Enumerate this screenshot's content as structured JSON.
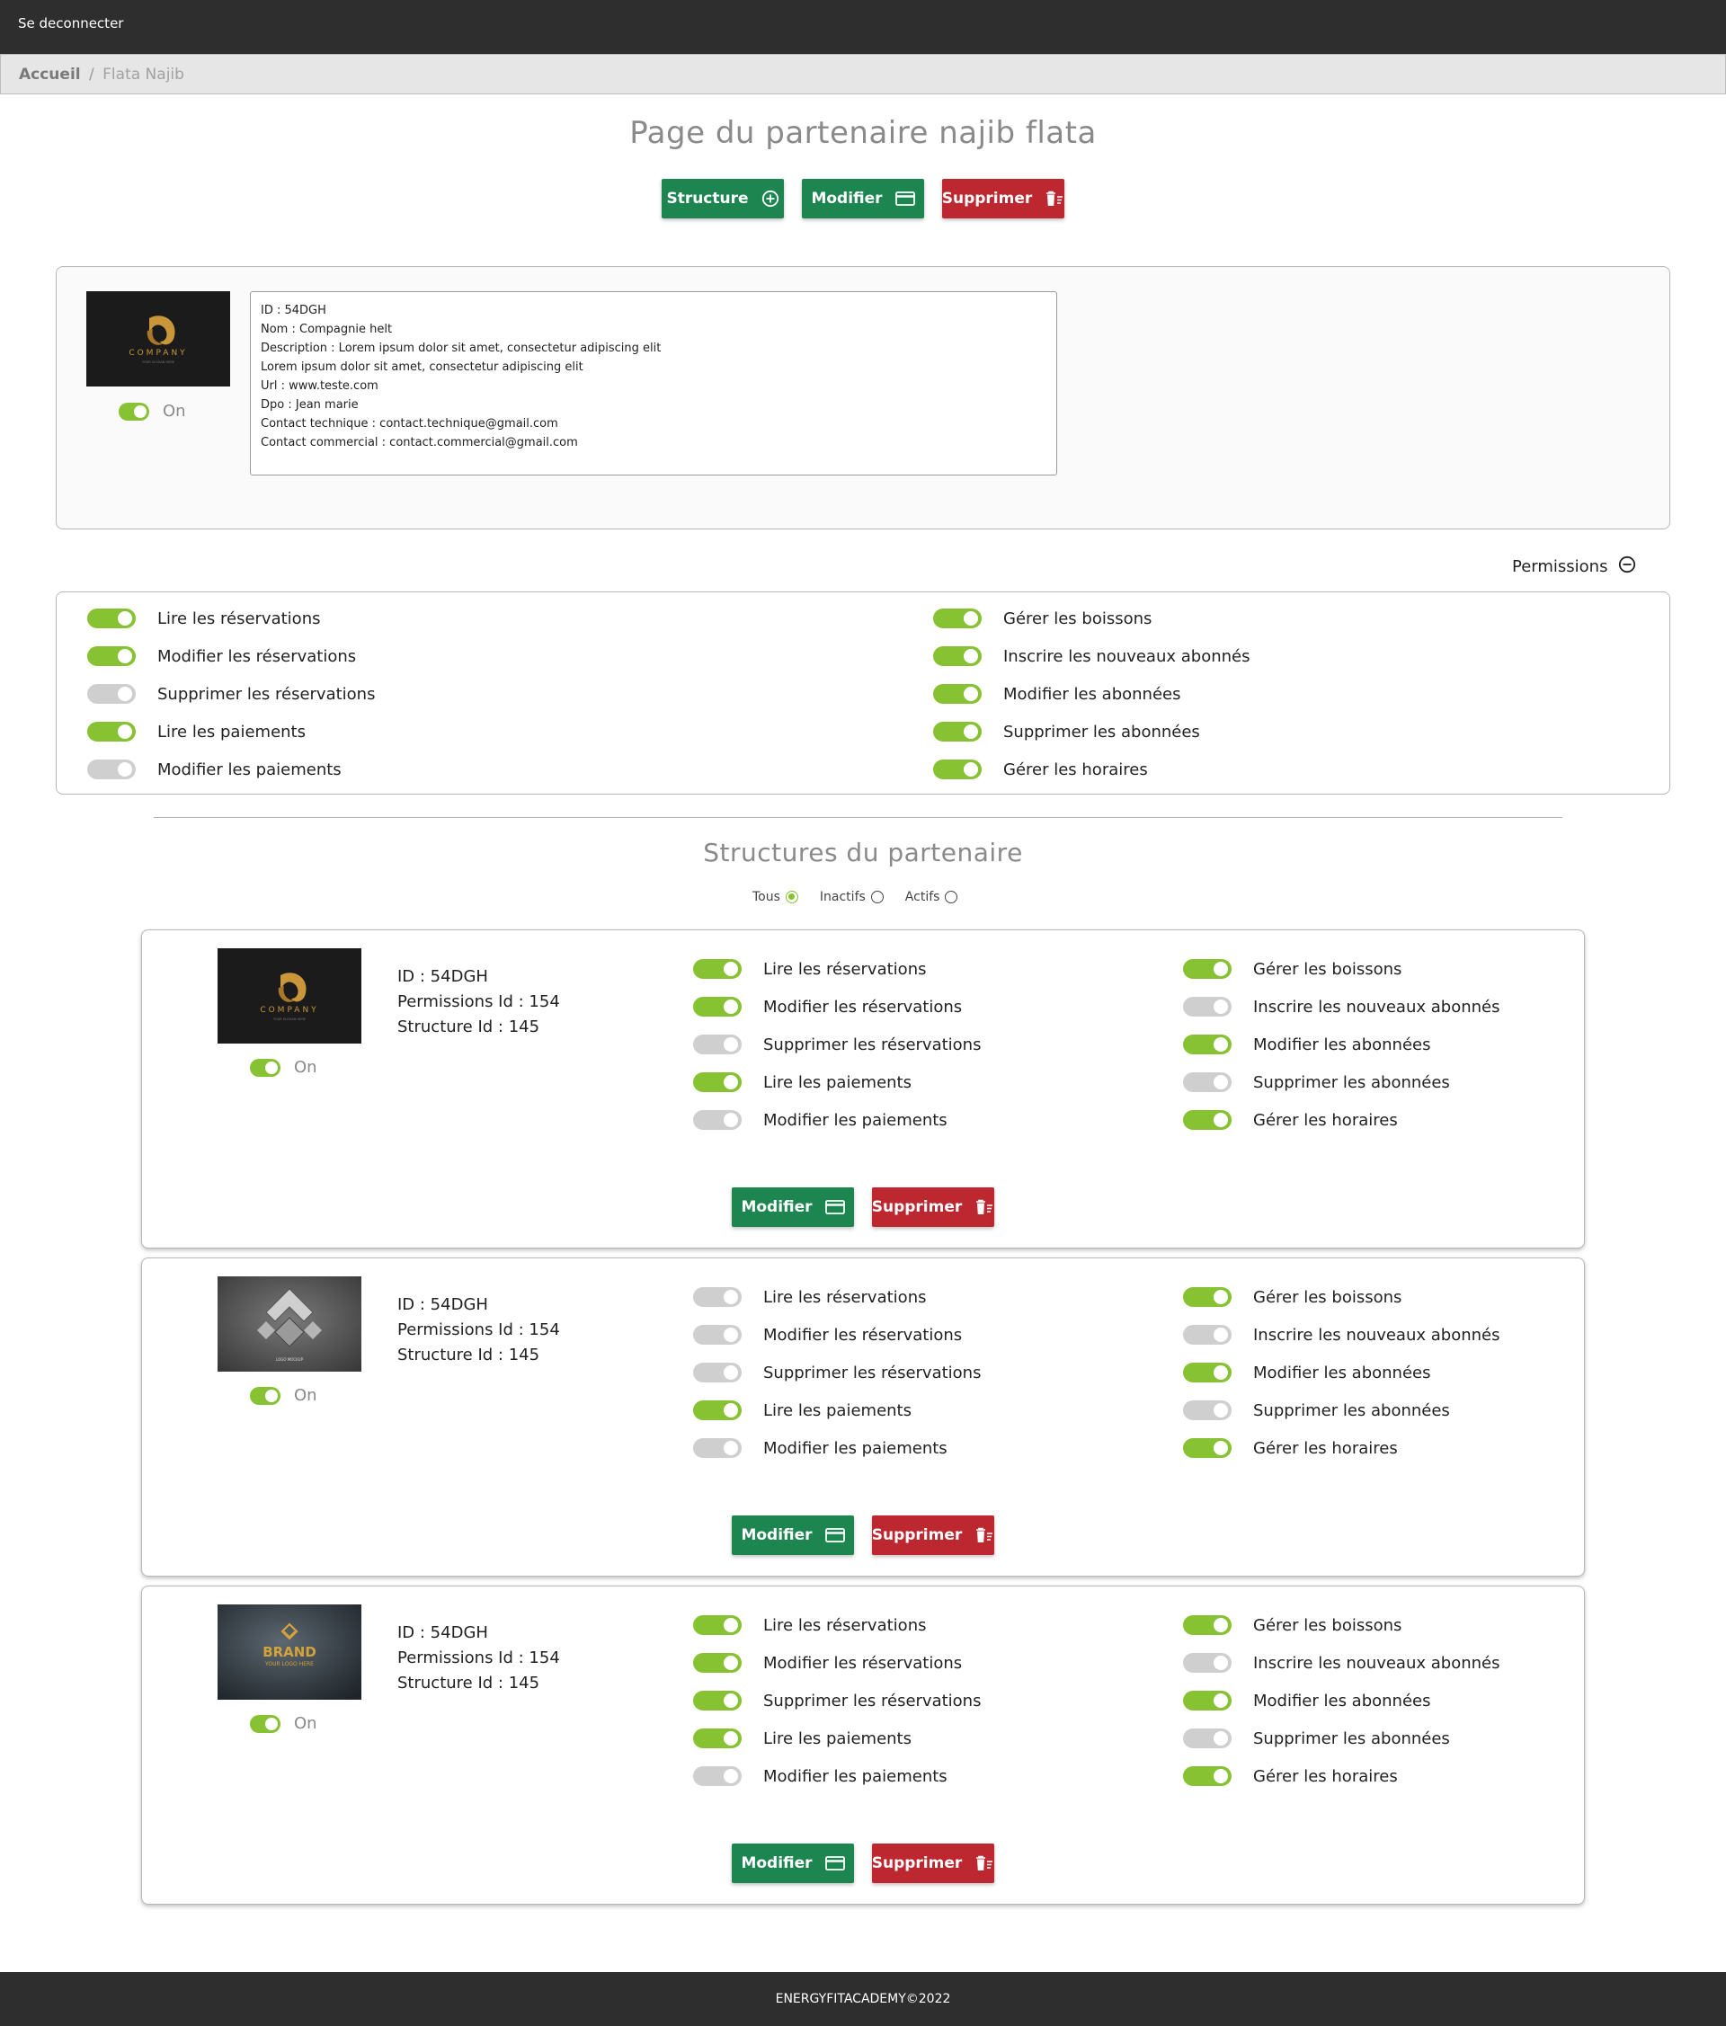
{
  "header": {
    "logout_label": "Se deconnecter"
  },
  "breadcrumb": {
    "home": "Accueil",
    "separator": "/",
    "current": "Flata Najib"
  },
  "page": {
    "title": "Page du partenaire najib flata",
    "buttons": {
      "structure": "Structure",
      "modify": "Modifier",
      "delete": "Supprimer"
    }
  },
  "partner": {
    "status_label": "On",
    "info_lines": [
      "ID : 54DGH",
      "Nom  : Compagnie helt",
      "Description : Lorem ipsum dolor sit amet, consectetur adipiscing elit",
      "Lorem ipsum dolor sit amet, consectetur adipiscing elit",
      "Url : www.teste.com",
      "Dpo  : Jean marie",
      "Contact technique : contact.technique@gmail.com",
      "Contact commercial : contact.commercial@gmail.com"
    ],
    "logo_text": {
      "brand": "COMPANY",
      "tagline": "YOUR SLOGAN HERE"
    }
  },
  "permissions": {
    "header_label": "Permissions",
    "left": [
      {
        "label": "Lire les réservations",
        "on": true
      },
      {
        "label": "Modifier les réservations",
        "on": true
      },
      {
        "label": "Supprimer les réservations",
        "on": false
      },
      {
        "label": "Lire les paiements",
        "on": true
      },
      {
        "label": "Modifier les paiements",
        "on": false
      }
    ],
    "right": [
      {
        "label": "Gérer les boissons",
        "on": true
      },
      {
        "label": "Inscrire les nouveaux abonnés",
        "on": true
      },
      {
        "label": "Modifier les abonnées",
        "on": true
      },
      {
        "label": "Supprimer les abonnées",
        "on": true
      },
      {
        "label": "Gérer les horaires",
        "on": true
      }
    ]
  },
  "structures": {
    "title": "Structures du partenaire",
    "filters": [
      {
        "label": "Tous",
        "checked": true
      },
      {
        "label": "Inactifs",
        "checked": false
      },
      {
        "label": "Actifs",
        "checked": false
      }
    ],
    "items": [
      {
        "status_label": "On",
        "id_line": "ID : 54DGH",
        "perm_id_line": "Permissions Id  : 154",
        "struct_id_line": "Structure Id : 145",
        "logo_text": {
          "brand": "COMPANY",
          "tagline": "YOUR SLOGAN HERE"
        },
        "left": [
          {
            "label": "Lire les réservations",
            "on": true
          },
          {
            "label": "Modifier les réservations",
            "on": true
          },
          {
            "label": "Supprimer les réservations",
            "on": false
          },
          {
            "label": "Lire les paiements",
            "on": true
          },
          {
            "label": "Modifier les paiements",
            "on": false
          }
        ],
        "right": [
          {
            "label": "Gérer les boissons",
            "on": true
          },
          {
            "label": "Inscrire les nouveaux abonnés",
            "on": false
          },
          {
            "label": "Modifier les abonnées",
            "on": true
          },
          {
            "label": "Supprimer les abonnées",
            "on": false
          },
          {
            "label": "Gérer les horaires",
            "on": true
          }
        ],
        "modify_label": "Modifier",
        "delete_label": "Supprimer"
      },
      {
        "status_label": "On",
        "id_line": "ID : 54DGH",
        "perm_id_line": "Permissions Id  : 154",
        "struct_id_line": "Structure Id : 145",
        "logo_text": {
          "brand": "LOGO MOCKUP"
        },
        "left": [
          {
            "label": "Lire les réservations",
            "on": false
          },
          {
            "label": "Modifier les réservations",
            "on": false
          },
          {
            "label": "Supprimer les réservations",
            "on": false
          },
          {
            "label": "Lire les paiements",
            "on": true
          },
          {
            "label": "Modifier les paiements",
            "on": false
          }
        ],
        "right": [
          {
            "label": "Gérer les boissons",
            "on": true
          },
          {
            "label": "Inscrire les nouveaux abonnés",
            "on": false
          },
          {
            "label": "Modifier les abonnées",
            "on": true
          },
          {
            "label": "Supprimer les abonnées",
            "on": false
          },
          {
            "label": "Gérer les horaires",
            "on": true
          }
        ],
        "modify_label": "Modifier",
        "delete_label": "Supprimer"
      },
      {
        "status_label": "On",
        "id_line": "ID : 54DGH",
        "perm_id_line": "Permissions Id  : 154",
        "struct_id_line": "Structure Id : 145",
        "logo_text": {
          "brand": "BRAND",
          "tagline": "YOUR LOGO HERE"
        },
        "left": [
          {
            "label": "Lire les réservations",
            "on": true
          },
          {
            "label": "Modifier les réservations",
            "on": true
          },
          {
            "label": "Supprimer les réservations",
            "on": true
          },
          {
            "label": "Lire les paiements",
            "on": true
          },
          {
            "label": "Modifier les paiements",
            "on": false
          }
        ],
        "right": [
          {
            "label": "Gérer les boissons",
            "on": true
          },
          {
            "label": "Inscrire les nouveaux abonnés",
            "on": false
          },
          {
            "label": "Modifier les abonnées",
            "on": true
          },
          {
            "label": "Supprimer les abonnées",
            "on": false
          },
          {
            "label": "Gérer les horaires",
            "on": true
          }
        ],
        "modify_label": "Modifier",
        "delete_label": "Supprimer"
      }
    ]
  },
  "footer": {
    "text": "ENERGYFITACADEMY©2022"
  },
  "colors": {
    "header_bg": "#2e2e2e",
    "toggle_on": "#86c232",
    "toggle_off": "#cfcfcf",
    "button_green": "#1d8650",
    "button_red": "#bc2730",
    "logo_gold": "#c9963a"
  }
}
